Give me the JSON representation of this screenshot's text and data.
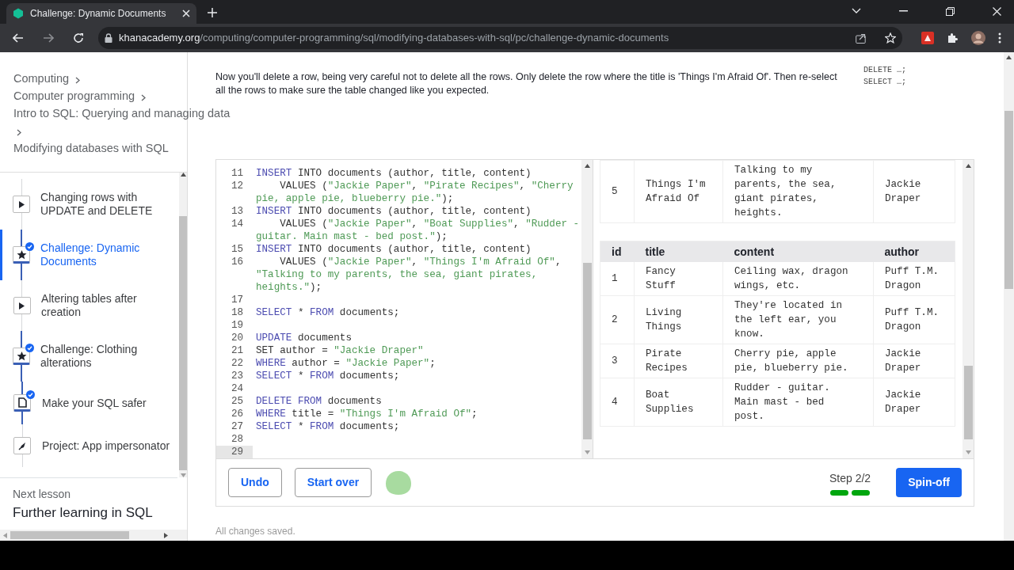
{
  "browser": {
    "tab_title": "Challenge: Dynamic Documents",
    "url_domain": "khanacademy.org",
    "url_path": "/computing/computer-programming/sql/modifying-databases-with-sql/pc/challenge-dynamic-documents"
  },
  "sidebar": {
    "breadcrumb": [
      "Computing",
      "Computer programming",
      "Intro to SQL: Querying and managing data",
      "Modifying databases with SQL"
    ],
    "items": [
      {
        "label": "Changing rows with UPDATE and DELETE",
        "kind": "video",
        "completed": false,
        "selected": false
      },
      {
        "label": "Challenge: Dynamic Documents",
        "kind": "challenge",
        "completed": true,
        "selected": true
      },
      {
        "label": "Altering tables after creation",
        "kind": "video",
        "completed": false,
        "selected": false
      },
      {
        "label": "Challenge: Clothing alterations",
        "kind": "challenge",
        "completed": true,
        "selected": false
      },
      {
        "label": "Make your SQL safer",
        "kind": "article",
        "completed": true,
        "selected": false
      },
      {
        "label": "Project: App impersonator",
        "kind": "project",
        "completed": false,
        "selected": false
      }
    ],
    "next_lesson": {
      "label": "Next lesson",
      "title": "Further learning in SQL"
    }
  },
  "instructions": "Now you'll delete a row, being very careful not to delete all the rows. Only delete the row where the title is 'Things I'm Afraid Of'. Then re-select all the rows to make sure the table changed like you expected.",
  "hints": [
    "DELETE …;",
    "SELECT …;"
  ],
  "editor": {
    "lines": [
      {
        "number": "11",
        "tokens": [
          {
            "kind": "kw",
            "text": "INSERT"
          },
          {
            "kind": "plain",
            "text": " INTO documents (author, title, content)"
          }
        ],
        "selected": false
      },
      {
        "number": "12",
        "tokens": [
          {
            "kind": "plain",
            "text": "    VALUES ("
          },
          {
            "kind": "str",
            "text": "\"Jackie Paper\""
          },
          {
            "kind": "plain",
            "text": ", "
          },
          {
            "kind": "str",
            "text": "\"Pirate Recipes\""
          },
          {
            "kind": "plain",
            "text": ", "
          },
          {
            "kind": "str",
            "text": "\"Cherry pie, apple pie, blueberry pie.\""
          },
          {
            "kind": "plain",
            "text": ");"
          }
        ],
        "selected": false
      },
      {
        "number": "13",
        "tokens": [
          {
            "kind": "kw",
            "text": "INSERT"
          },
          {
            "kind": "plain",
            "text": " INTO documents (author, title, content)"
          }
        ],
        "selected": false
      },
      {
        "number": "14",
        "tokens": [
          {
            "kind": "plain",
            "text": "    VALUES ("
          },
          {
            "kind": "str",
            "text": "\"Jackie Paper\""
          },
          {
            "kind": "plain",
            "text": ", "
          },
          {
            "kind": "str",
            "text": "\"Boat Supplies\""
          },
          {
            "kind": "plain",
            "text": ", "
          },
          {
            "kind": "str",
            "text": "\"Rudder - guitar. Main mast - bed post.\""
          },
          {
            "kind": "plain",
            "text": ");"
          }
        ],
        "selected": false
      },
      {
        "number": "15",
        "tokens": [
          {
            "kind": "kw",
            "text": "INSERT"
          },
          {
            "kind": "plain",
            "text": " INTO documents (author, title, content)"
          }
        ],
        "selected": false
      },
      {
        "number": "16",
        "tokens": [
          {
            "kind": "plain",
            "text": "    VALUES ("
          },
          {
            "kind": "str",
            "text": "\"Jackie Paper\""
          },
          {
            "kind": "plain",
            "text": ", "
          },
          {
            "kind": "str",
            "text": "\"Things I'm Afraid Of\""
          },
          {
            "kind": "plain",
            "text": ", "
          },
          {
            "kind": "str",
            "text": "\"Talking to my parents, the sea, giant pirates, heights.\""
          },
          {
            "kind": "plain",
            "text": ");"
          }
        ],
        "selected": false
      },
      {
        "number": "17",
        "selected": false
      },
      {
        "number": "18",
        "tokens": [
          {
            "kind": "kw",
            "text": "SELECT"
          },
          {
            "kind": "plain",
            "text": " * "
          },
          {
            "kind": "kw",
            "text": "FROM"
          },
          {
            "kind": "plain",
            "text": " documents;"
          }
        ],
        "selected": false
      },
      {
        "number": "19",
        "selected": false
      },
      {
        "number": "20",
        "tokens": [
          {
            "kind": "kw",
            "text": "UPDATE"
          },
          {
            "kind": "plain",
            "text": " documents"
          }
        ],
        "selected": false
      },
      {
        "number": "21",
        "tokens": [
          {
            "kind": "plain",
            "text": "SET author = "
          },
          {
            "kind": "str",
            "text": "\"Jackie Draper\""
          }
        ],
        "selected": false
      },
      {
        "number": "22",
        "tokens": [
          {
            "kind": "kw",
            "text": "WHERE"
          },
          {
            "kind": "plain",
            "text": " author = "
          },
          {
            "kind": "str",
            "text": "\"Jackie Paper\""
          },
          {
            "kind": "plain",
            "text": ";"
          }
        ],
        "selected": false
      },
      {
        "number": "23",
        "tokens": [
          {
            "kind": "kw",
            "text": "SELECT"
          },
          {
            "kind": "plain",
            "text": " * "
          },
          {
            "kind": "kw",
            "text": "FROM"
          },
          {
            "kind": "plain",
            "text": " documents;"
          }
        ],
        "selected": false
      },
      {
        "number": "24",
        "selected": false
      },
      {
        "number": "25",
        "tokens": [
          {
            "kind": "kw",
            "text": "DELETE FROM"
          },
          {
            "kind": "plain",
            "text": " documents"
          }
        ],
        "selected": false
      },
      {
        "number": "26",
        "tokens": [
          {
            "kind": "kw",
            "text": "WHERE"
          },
          {
            "kind": "plain",
            "text": " title = "
          },
          {
            "kind": "str",
            "text": "\"Things I'm Afraid Of\""
          },
          {
            "kind": "plain",
            "text": ";"
          }
        ],
        "selected": false
      },
      {
        "number": "27",
        "tokens": [
          {
            "kind": "kw",
            "text": "SELECT"
          },
          {
            "kind": "plain",
            "text": " * "
          },
          {
            "kind": "kw",
            "text": "FROM"
          },
          {
            "kind": "plain",
            "text": " documents;"
          }
        ],
        "selected": false
      },
      {
        "number": "28",
        "selected": false
      },
      {
        "number": "29",
        "selected": true
      }
    ]
  },
  "results": [
    {
      "rows": [
        [
          "5",
          "Things I'm Afraid Of",
          "Talking to my parents, the sea, giant pirates, heights.",
          "Jackie Draper"
        ]
      ]
    },
    {
      "columns": [
        "id",
        "title",
        "content",
        "author"
      ],
      "rows": [
        [
          "1",
          "Fancy Stuff",
          "Ceiling wax, dragon wings, etc.",
          "Puff T.M. Dragon"
        ],
        [
          "2",
          "Living Things",
          "They're located in the left ear, you know.",
          "Puff T.M. Dragon"
        ],
        [
          "3",
          "Pirate Recipes",
          "Cherry pie, apple pie, blueberry pie.",
          "Jackie Draper"
        ],
        [
          "4",
          "Boat Supplies",
          "Rudder - guitar. Main mast - bed post.",
          "Jackie Draper"
        ]
      ]
    }
  ],
  "buttons": [
    "Undo",
    "Start over"
  ],
  "step": {
    "label": "Step 2/2",
    "steps": [
      {
        "completed": true
      },
      {
        "completed": true
      }
    ]
  },
  "spin_off": "Spin-off",
  "status": "All changes saved."
}
